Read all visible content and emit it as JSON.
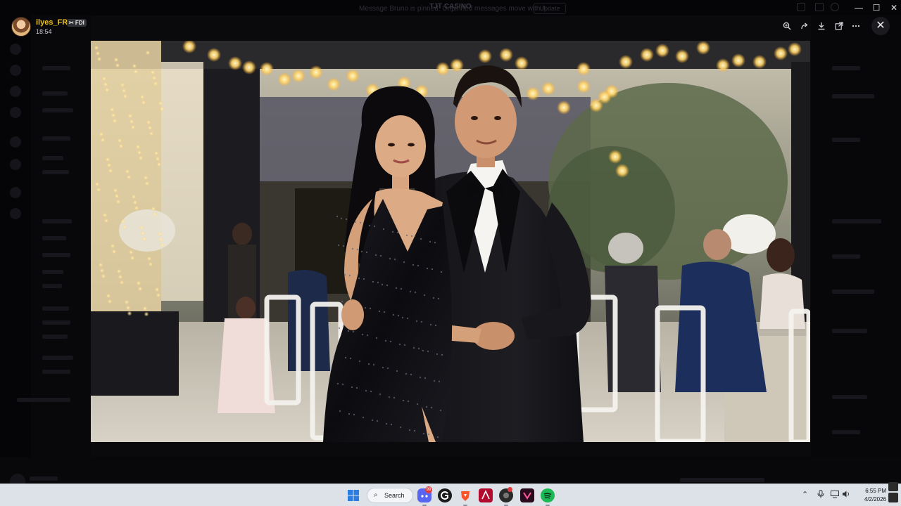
{
  "window": {
    "app_title": "TJT CASINO",
    "minimize": "—",
    "maximize": "☐",
    "close": "✕"
  },
  "background_app": {
    "notice_text": "Message Bruno is pinned. Unpinned messages move with it",
    "notice_button": "Update"
  },
  "viewer": {
    "username": "ilyes_FR",
    "tag": "✂ FDI",
    "timestamp": "18:54",
    "tools": [
      "zoom-in-icon",
      "forward-icon",
      "download-icon",
      "open-external-icon",
      "more-icon"
    ],
    "close_label": "✕"
  },
  "taskbar": {
    "search_label": "Search",
    "discord_badge": "99",
    "time": "6:55 PM",
    "date": "4/2/2026"
  },
  "colors": {
    "username": "#f0c419",
    "taskbar": "#dde1e8",
    "viewer_bg": "#000000"
  }
}
